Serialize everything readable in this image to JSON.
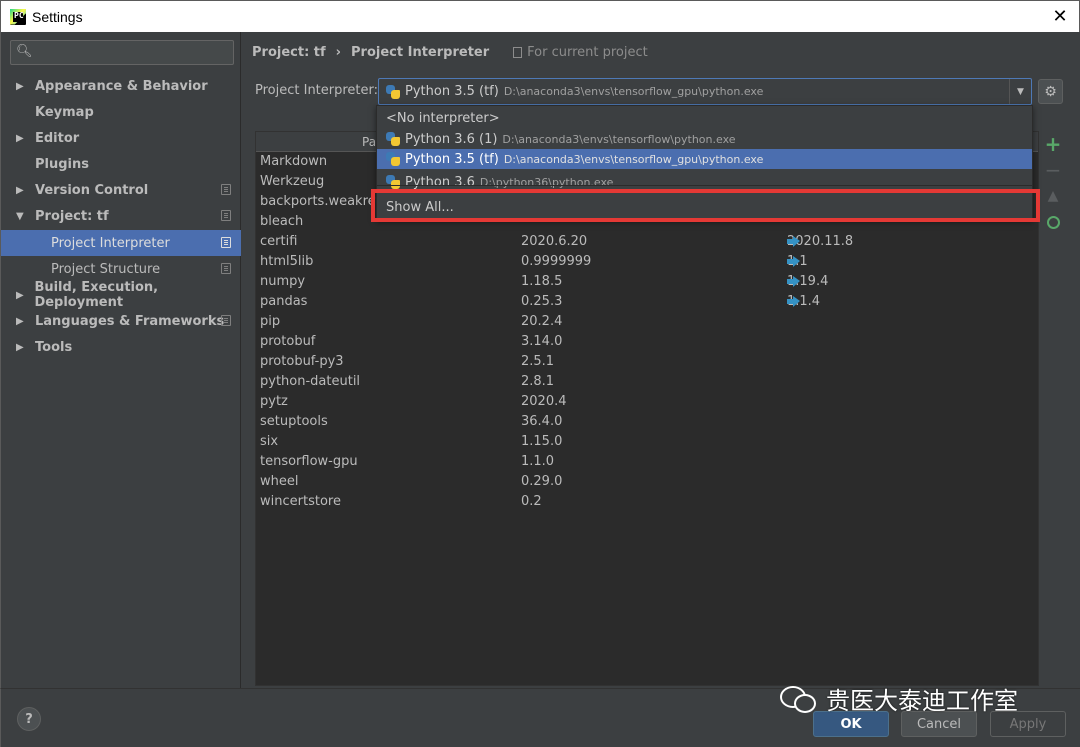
{
  "window": {
    "title": "Settings",
    "close_glyph": "✕"
  },
  "search": {
    "placeholder": "",
    "icon": "search-icon"
  },
  "sidebar": {
    "items": [
      {
        "label": "Appearance & Behavior",
        "arrow": "▶"
      },
      {
        "label": "Keymap"
      },
      {
        "label": "Editor",
        "arrow": "▶"
      },
      {
        "label": "Plugins"
      },
      {
        "label": "Version Control",
        "arrow": "▶"
      },
      {
        "label": "Project: tf",
        "arrow": "▼"
      },
      {
        "label": "Project Interpreter"
      },
      {
        "label": "Project Structure"
      },
      {
        "label": "Build, Execution, Deployment",
        "arrow": "▶"
      },
      {
        "label": "Languages & Frameworks",
        "arrow": "▶"
      },
      {
        "label": "Tools",
        "arrow": "▶"
      }
    ]
  },
  "breadcrumb": {
    "project": "Project: tf",
    "separator": "›",
    "page": "Project Interpreter",
    "scope": "For current project"
  },
  "interpreter": {
    "label": "Project Interpreter:",
    "selected_name": "Python 3.5 (tf)",
    "selected_path": "D:\\anaconda3\\envs\\tensorflow_gpu\\python.exe",
    "dropdown_glyph": "▼",
    "gear_glyph": "⚙"
  },
  "popup": {
    "items": [
      {
        "name": "<No interpreter>",
        "path": ""
      },
      {
        "name": "Python 3.6 (1)",
        "path": "D:\\anaconda3\\envs\\tensorflow\\python.exe"
      },
      {
        "name": "Python 3.5 (tf)",
        "path": "D:\\anaconda3\\envs\\tensorflow_gpu\\python.exe"
      },
      {
        "name": "Python 3.6",
        "path": "D:\\python36\\python.exe"
      },
      {
        "name": "Show All...",
        "path": ""
      }
    ]
  },
  "packages": {
    "header_package": "Pa",
    "rows": [
      {
        "name": "Markdown",
        "version": "",
        "latest": ""
      },
      {
        "name": "Werkzeug",
        "version": "",
        "latest": ""
      },
      {
        "name": "backports.weakref",
        "version": "",
        "latest": ""
      },
      {
        "name": "bleach",
        "version": "",
        "latest": ""
      },
      {
        "name": "certifi",
        "version": "2020.6.20",
        "latest": "2020.11.8"
      },
      {
        "name": "html5lib",
        "version": "0.9999999",
        "latest": "1.1"
      },
      {
        "name": "numpy",
        "version": "1.18.5",
        "latest": "1.19.4"
      },
      {
        "name": "pandas",
        "version": "0.25.3",
        "latest": "1.1.4"
      },
      {
        "name": "pip",
        "version": "20.2.4",
        "latest": ""
      },
      {
        "name": "protobuf",
        "version": "3.14.0",
        "latest": ""
      },
      {
        "name": "protobuf-py3",
        "version": "2.5.1",
        "latest": ""
      },
      {
        "name": "python-dateutil",
        "version": "2.8.1",
        "latest": ""
      },
      {
        "name": "pytz",
        "version": "2020.4",
        "latest": ""
      },
      {
        "name": "setuptools",
        "version": "36.4.0",
        "latest": ""
      },
      {
        "name": "six",
        "version": "1.15.0",
        "latest": ""
      },
      {
        "name": "tensorflow-gpu",
        "version": "1.1.0",
        "latest": ""
      },
      {
        "name": "wheel",
        "version": "0.29.0",
        "latest": ""
      },
      {
        "name": "wincertstore",
        "version": "0.2",
        "latest": ""
      }
    ]
  },
  "tools": {
    "add": "+",
    "remove": "−",
    "upgrade": "▲"
  },
  "footer": {
    "help": "?",
    "ok": "OK",
    "cancel": "Cancel",
    "apply": "Apply",
    "watermark": "贵医大泰迪工作室"
  },
  "colors": {
    "accent": "#4b6eaf",
    "highlight": "#e53935",
    "ok_button": "#365880",
    "upgrade_arrow": "#3592c4",
    "add_green": "#59a869"
  }
}
